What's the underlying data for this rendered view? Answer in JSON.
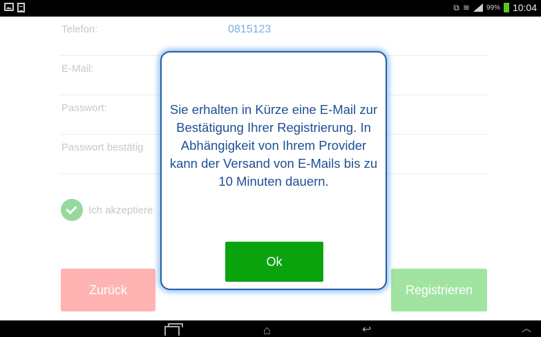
{
  "status_bar": {
    "battery_percent": "99%",
    "time": "10:04",
    "icons": [
      "image-icon",
      "document-icon",
      "screenshot-icon",
      "wifi-icon",
      "signal-icon",
      "battery-icon"
    ]
  },
  "form": {
    "rows": [
      {
        "label": "Telefon:",
        "value": "0815123"
      },
      {
        "label": "E-Mail:",
        "value": ""
      },
      {
        "label": "Passwort:",
        "value": ""
      },
      {
        "label": "Passwort bestätig",
        "value": ""
      }
    ],
    "terms_label": "Ich akzeptiere",
    "back_label": "Zurück",
    "register_label": "Registrieren"
  },
  "dialog": {
    "message": "Sie erhalten in Kürze eine E-Mail zur Bestätigung Ihrer Registrierung. In Abhängigkeit von Ihrem Provider kann der Versand von E-Mails bis zu 10 Minuten dauern.",
    "ok_label": "Ok"
  },
  "colors": {
    "accent_blue": "#1f5fa8",
    "ok_green": "#0aa30e",
    "back_red": "#ff8b8b",
    "register_green": "#6fd66f",
    "check_green": "#5fc46a"
  },
  "nav_bar": {
    "icons": [
      "recent-apps-icon",
      "home-icon",
      "back-icon",
      "chevron-up-icon"
    ]
  }
}
